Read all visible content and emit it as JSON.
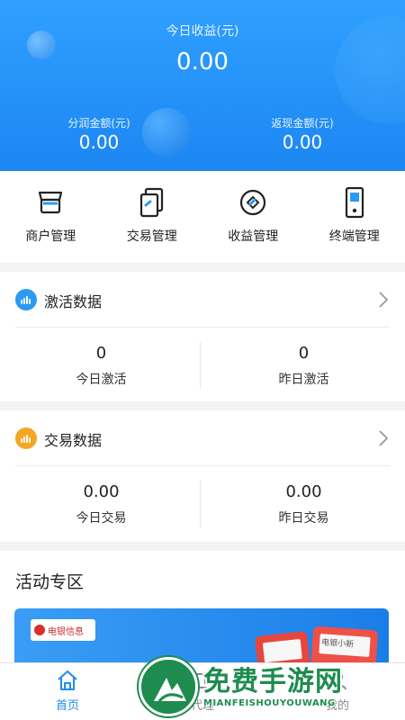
{
  "header": {
    "title": "今日收益(元)",
    "value": "0.00",
    "left_label": "分润金额(元)",
    "left_value": "0.00",
    "right_label": "返现金额(元)",
    "right_value": "0.00"
  },
  "menu": [
    {
      "label": "商户管理",
      "icon": "merchant-icon"
    },
    {
      "label": "交易管理",
      "icon": "documents-icon"
    },
    {
      "label": "收益管理",
      "icon": "coin-icon"
    },
    {
      "label": "终端管理",
      "icon": "terminal-icon"
    }
  ],
  "activation": {
    "title": "激活数据",
    "icon_color": "#2b9af3",
    "today_value": "0",
    "today_label": "今日激活",
    "yesterday_value": "0",
    "yesterday_label": "昨日激活"
  },
  "transactions": {
    "title": "交易数据",
    "icon_color": "#f5a623",
    "today_value": "0.00",
    "today_label": "今日交易",
    "yesterday_value": "0.00",
    "yesterday_label": "昨日交易"
  },
  "activity": {
    "title": "活动专区",
    "banner_logo": "电银信息",
    "banner_device_label": "电银小新"
  },
  "tabs": [
    {
      "label": "首页",
      "active": true
    },
    {
      "label": "代理",
      "active": false
    },
    {
      "label": "我的",
      "active": false
    }
  ],
  "watermark": {
    "text": "免费手游网",
    "sub": "MIANFEISHOUYOUWANG"
  },
  "colors": {
    "accent": "#1f8bf0",
    "header_top": "#2fa0ff",
    "header_bottom": "#1c86f2",
    "watermark": "#1e8c4f"
  }
}
